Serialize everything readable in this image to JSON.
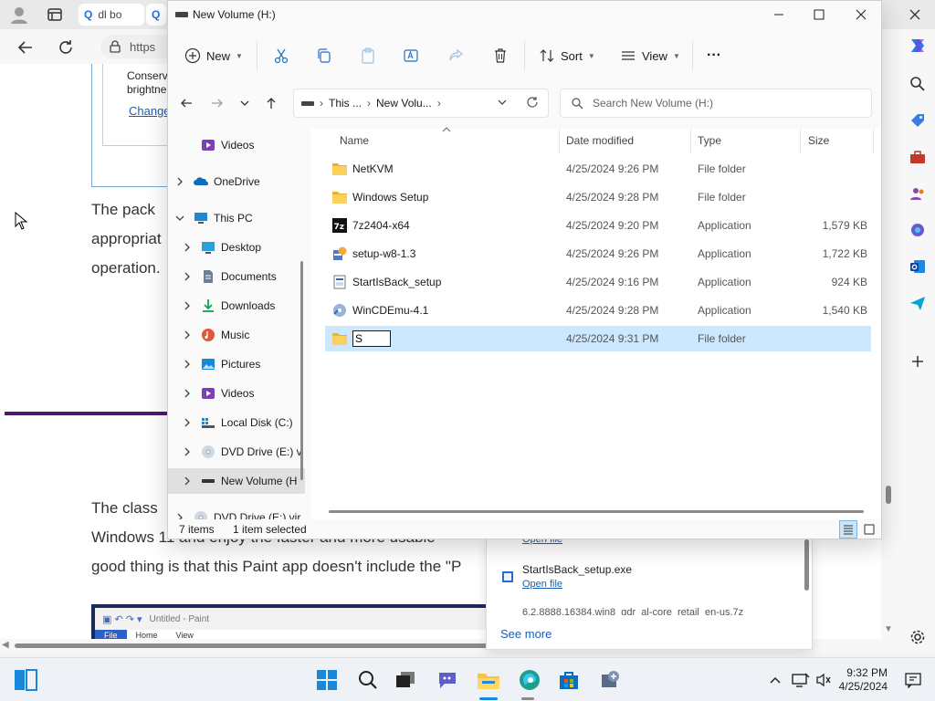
{
  "browser": {
    "tabs": [
      {
        "label": "dl bo"
      },
      {
        "label": ""
      }
    ],
    "address_partial": "https"
  },
  "webpage": {
    "setting_card": {
      "line1": "Conserv",
      "line2": "brightne",
      "link": "Change"
    },
    "para1": {
      "line1": "The pack",
      "line2": "appropriat",
      "line3": "operation."
    },
    "para2": {
      "line1": "The class",
      "line2": "Windows 11 and enjoy the faster and more usable",
      "line3": "good thing is that this Paint app doesn't include the \"P"
    },
    "paint_thumb": {
      "title": "Untitled - Paint",
      "menu": [
        "File",
        "Home",
        "View"
      ]
    }
  },
  "downloads": {
    "top_partial": "Open file",
    "items": [
      {
        "name": "StartIsBack_setup.exe",
        "action": "Open file"
      },
      {
        "name": "6.2.8888.16384.win8_gdr_al-core_retail_en-us.7z",
        "action": ""
      }
    ],
    "see_more": "See more"
  },
  "explorer": {
    "title": "New Volume (H:)",
    "toolbar": {
      "new": "New",
      "sort": "Sort",
      "view": "View",
      "more": "···"
    },
    "breadcrumb": [
      "This ...",
      "New Volu..."
    ],
    "search_placeholder": "Search New Volume (H:)",
    "nav": [
      {
        "label": "Videos",
        "icon": "video-folder-icon",
        "level": 1,
        "expand": false
      },
      {
        "label": "OneDrive",
        "icon": "onedrive-icon",
        "level": 0,
        "expand": true
      },
      {
        "label": "This PC",
        "icon": "this-pc-icon",
        "level": 0,
        "expand": "open"
      },
      {
        "label": "Desktop",
        "icon": "desktop-icon",
        "level": 1,
        "expand": true
      },
      {
        "label": "Documents",
        "icon": "documents-icon",
        "level": 1,
        "expand": true
      },
      {
        "label": "Downloads",
        "icon": "downloads-icon",
        "level": 1,
        "expand": true
      },
      {
        "label": "Music",
        "icon": "music-icon",
        "level": 1,
        "expand": true
      },
      {
        "label": "Pictures",
        "icon": "pictures-icon",
        "level": 1,
        "expand": true
      },
      {
        "label": "Videos",
        "icon": "video-folder-icon",
        "level": 1,
        "expand": true
      },
      {
        "label": "Local Disk (C:)",
        "icon": "drive-icon",
        "level": 1,
        "expand": true
      },
      {
        "label": "DVD Drive (E:) v",
        "icon": "dvd-icon",
        "level": 1,
        "expand": true
      },
      {
        "label": "New Volume (H",
        "icon": "usb-drive-icon",
        "level": 1,
        "expand": true,
        "selected": true
      },
      {
        "label": "DVD Drive (E:) vir",
        "icon": "dvd-icon",
        "level": 0,
        "expand": true
      }
    ],
    "columns": {
      "name": "Name",
      "date": "Date modified",
      "type": "Type",
      "size": "Size"
    },
    "files": [
      {
        "name": "NetKVM",
        "date": "4/25/2024 9:26 PM",
        "type": "File folder",
        "size": "",
        "icon": "folder"
      },
      {
        "name": "Windows Setup",
        "date": "4/25/2024 9:28 PM",
        "type": "File folder",
        "size": "",
        "icon": "folder"
      },
      {
        "name": "7z2404-x64",
        "date": "4/25/2024 9:20 PM",
        "type": "Application",
        "size": "1,579 KB",
        "icon": "7z"
      },
      {
        "name": "setup-w8-1.3",
        "date": "4/25/2024 9:26 PM",
        "type": "Application",
        "size": "1,722 KB",
        "icon": "setup"
      },
      {
        "name": "StartIsBack_setup",
        "date": "4/25/2024 9:16 PM",
        "type": "Application",
        "size": "924 KB",
        "icon": "app"
      },
      {
        "name": "WinCDEmu-4.1",
        "date": "4/25/2024 9:28 PM",
        "type": "Application",
        "size": "1,540 KB",
        "icon": "cd"
      }
    ],
    "new_item": {
      "rename_value": "S",
      "date": "4/25/2024 9:31 PM",
      "type": "File folder"
    },
    "status": {
      "count": "7 items",
      "selection": "1 item selected"
    }
  },
  "taskbar": {
    "time": "9:32 PM",
    "date": "4/25/2024"
  },
  "colors": {
    "accent": "#0067c0",
    "selection": "#cce8ff",
    "folder": "#f4c542"
  }
}
